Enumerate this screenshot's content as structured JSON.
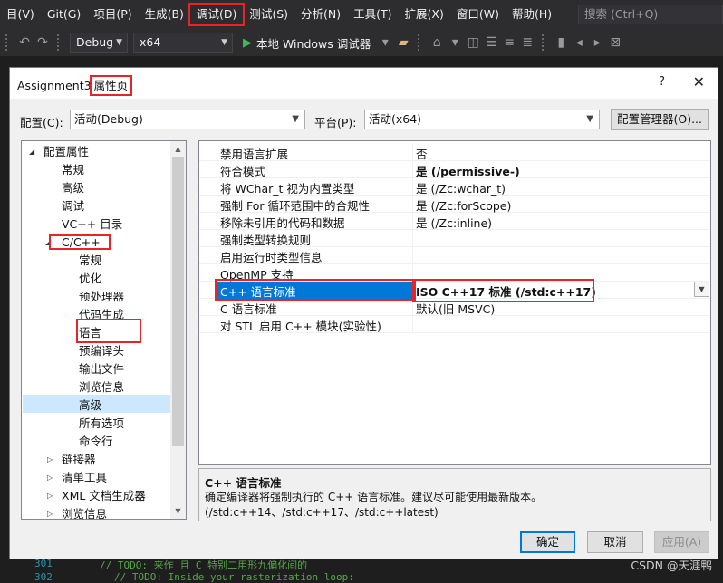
{
  "menubar": {
    "items": [
      "目(V)",
      "Git(G)",
      "项目(P)",
      "生成(B)",
      "调试(D)",
      "测试(S)",
      "分析(N)",
      "工具(T)",
      "扩展(X)",
      "窗口(W)",
      "帮助(H)"
    ],
    "search_placeholder": "搜索 (Ctrl+Q)"
  },
  "toolbar": {
    "config": "Debug",
    "platform": "x64",
    "run_label": "本地 Windows 调试器"
  },
  "dialog": {
    "title_prefix": "Assignment3",
    "title_suffix": "属性页",
    "help": "?",
    "close": "✕",
    "config_label": "配置(C):",
    "config_value": "活动(Debug)",
    "platform_label": "平台(P):",
    "platform_value": "活动(x64)",
    "config_manager": "配置管理器(O)...",
    "tree": [
      {
        "label": "配置属性",
        "level": 0,
        "exp": "open"
      },
      {
        "label": "常规",
        "level": 1
      },
      {
        "label": "高级",
        "level": 1
      },
      {
        "label": "调试",
        "level": 1
      },
      {
        "label": "VC++ 目录",
        "level": 1
      },
      {
        "label": "C/C++",
        "level": 1,
        "exp": "open"
      },
      {
        "label": "常规",
        "level": 2
      },
      {
        "label": "优化",
        "level": 2
      },
      {
        "label": "预处理器",
        "level": 2
      },
      {
        "label": "代码生成",
        "level": 2
      },
      {
        "label": "语言",
        "level": 2,
        "selected": true
      },
      {
        "label": "预编译头",
        "level": 2
      },
      {
        "label": "输出文件",
        "level": 2
      },
      {
        "label": "浏览信息",
        "level": 2
      },
      {
        "label": "高级",
        "level": 2
      },
      {
        "label": "所有选项",
        "level": 2
      },
      {
        "label": "命令行",
        "level": 2
      },
      {
        "label": "链接器",
        "level": 1,
        "exp": "closed"
      },
      {
        "label": "清单工具",
        "level": 1,
        "exp": "closed"
      },
      {
        "label": "XML 文档生成器",
        "level": 1,
        "exp": "closed"
      },
      {
        "label": "浏览信息",
        "level": 1,
        "exp": "closed"
      }
    ],
    "properties": [
      {
        "name": "禁用语言扩展",
        "value": "否"
      },
      {
        "name": "符合模式",
        "value": "是 (/permissive-)",
        "bold": true
      },
      {
        "name": "将 WChar_t 视为内置类型",
        "value": "是 (/Zc:wchar_t)"
      },
      {
        "name": "强制 For 循环范围中的合规性",
        "value": "是 (/Zc:forScope)"
      },
      {
        "name": "移除未引用的代码和数据",
        "value": "是 (/Zc:inline)"
      },
      {
        "name": "强制类型转换规则",
        "value": ""
      },
      {
        "name": "启用运行时类型信息",
        "value": ""
      },
      {
        "name": "OpenMP 支持",
        "value": ""
      },
      {
        "name": "C++ 语言标准",
        "value": "ISO C++17 标准 (/std:c++17)",
        "bold": true,
        "selected": true
      },
      {
        "name": "C 语言标准",
        "value": "默认(旧 MSVC)"
      },
      {
        "name": "对 STL 启用 C++ 模块(实验性)",
        "value": ""
      }
    ],
    "desc_title": "C++ 语言标准",
    "desc_text": "确定编译器将强制执行的 C++ 语言标准。建议尽可能使用最新版本。(/std:c++14、/std:c++17、/std:c++latest)",
    "ok": "确定",
    "cancel": "取消",
    "apply": "应用(A)"
  },
  "code": {
    "line1_num": "301",
    "line1": "// TODO: 来作 且 C 特别二用形九偏化间的",
    "line2_num": "302",
    "line2": "// TODO: Inside your rasterization loop:"
  },
  "watermark": "CSDN @天涯鸭"
}
